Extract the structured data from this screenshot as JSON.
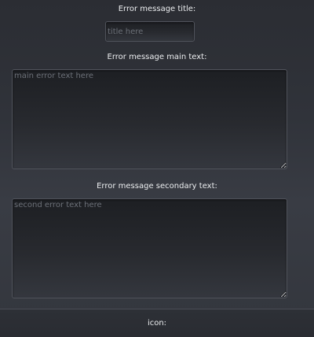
{
  "form": {
    "title_label": "Error message title:",
    "title_placeholder": "title here",
    "title_value": "",
    "main_label": "Error message main text:",
    "main_placeholder": "main error text here",
    "main_value": "",
    "secondary_label": "Error message secondary text:",
    "secondary_placeholder": "second error text here",
    "secondary_value": "",
    "icon_label": "icon:"
  }
}
